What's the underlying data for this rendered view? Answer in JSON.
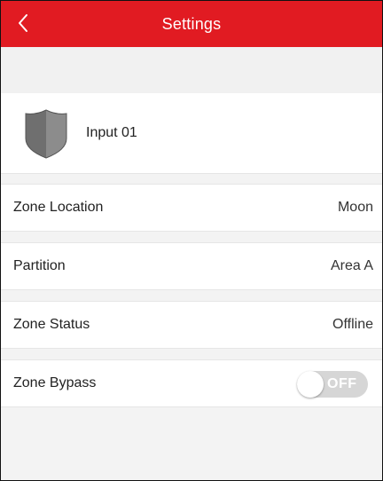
{
  "header": {
    "title": "Settings",
    "back_icon": "chevron-left-icon",
    "color": "#e11b22"
  },
  "device": {
    "icon": "shield-icon",
    "name": "Input 01"
  },
  "rows": [
    {
      "label": "Zone Location",
      "value": "Moon"
    },
    {
      "label": "Partition",
      "value": "Area A"
    },
    {
      "label": "Zone Status",
      "value": "Offline"
    }
  ],
  "bypass": {
    "label": "Zone Bypass",
    "state": "OFF"
  }
}
